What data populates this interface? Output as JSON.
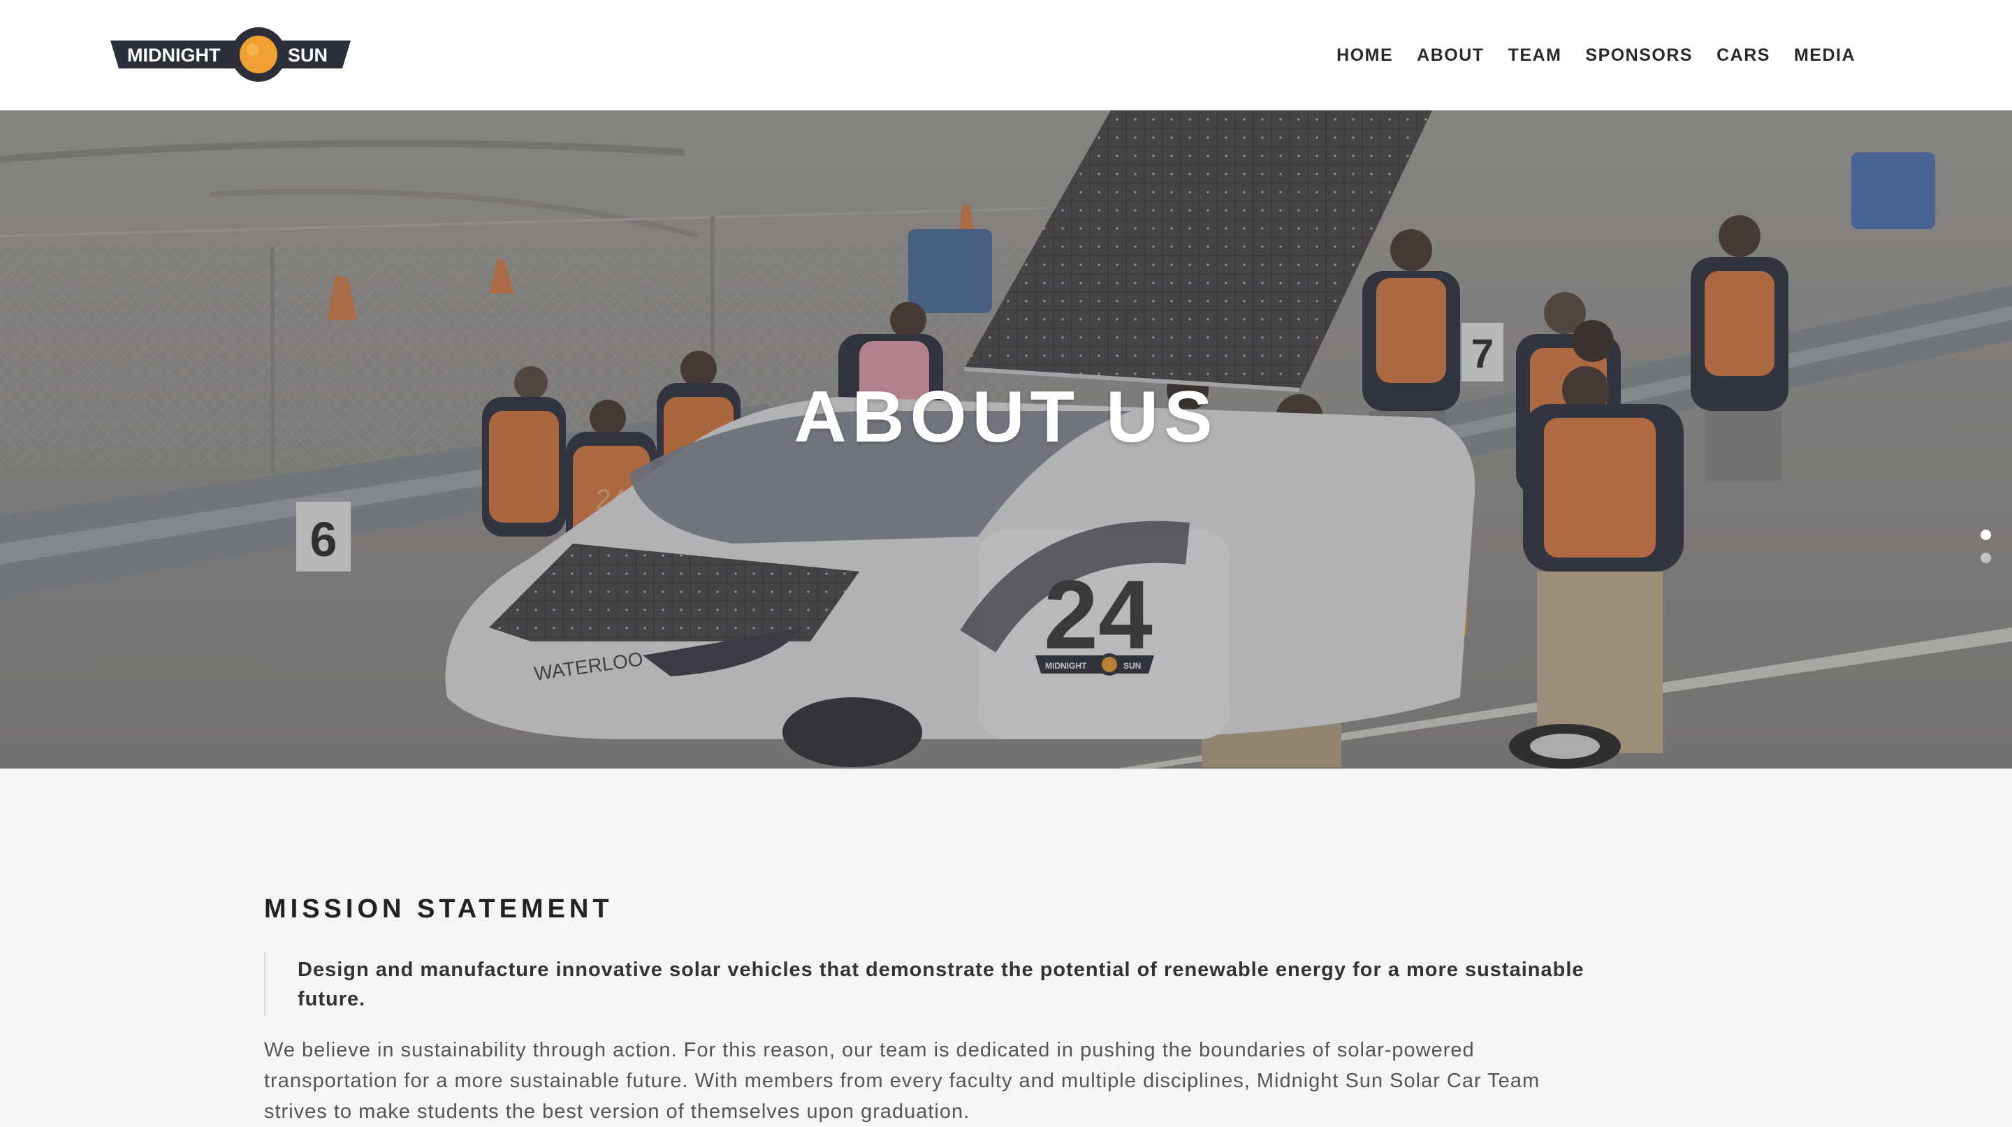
{
  "header": {
    "logo": {
      "left_text": "MIDNIGHT",
      "right_text": "SUN",
      "sun_color": "#f0a030",
      "badge_color": "#2c2f3a"
    },
    "nav": [
      {
        "label": "HOME"
      },
      {
        "label": "ABOUT"
      },
      {
        "label": "TEAM"
      },
      {
        "label": "SPONSORS"
      },
      {
        "label": "CARS"
      },
      {
        "label": "MEDIA"
      }
    ]
  },
  "hero": {
    "title": "ABOUT US",
    "slides": [
      {
        "active": true
      },
      {
        "active": false
      }
    ],
    "photo_text": {
      "car_number": "24",
      "car_badge_left": "MIDNIGHT",
      "car_badge_right": "SUN",
      "car_school": "WATERLOO",
      "sign_left": "6",
      "sign_right": "7",
      "vest_number": "24"
    }
  },
  "mission": {
    "title": "MISSION STATEMENT",
    "quote": "Design and manufacture innovative solar vehicles that demonstrate the potential of renewable energy for a more sustainable future.",
    "body": "We believe in sustainability through action. For this reason, our team is dedicated in pushing the boundaries of solar-powered transportation for a more sustainable future. With members from every faculty and multiple disciplines, Midnight Sun Solar Car Team strives to make students the best version of themselves upon graduation."
  },
  "colors": {
    "accent_orange": "#e8843c",
    "text_dark": "#222222",
    "page_bg": "#f5f5f5"
  }
}
